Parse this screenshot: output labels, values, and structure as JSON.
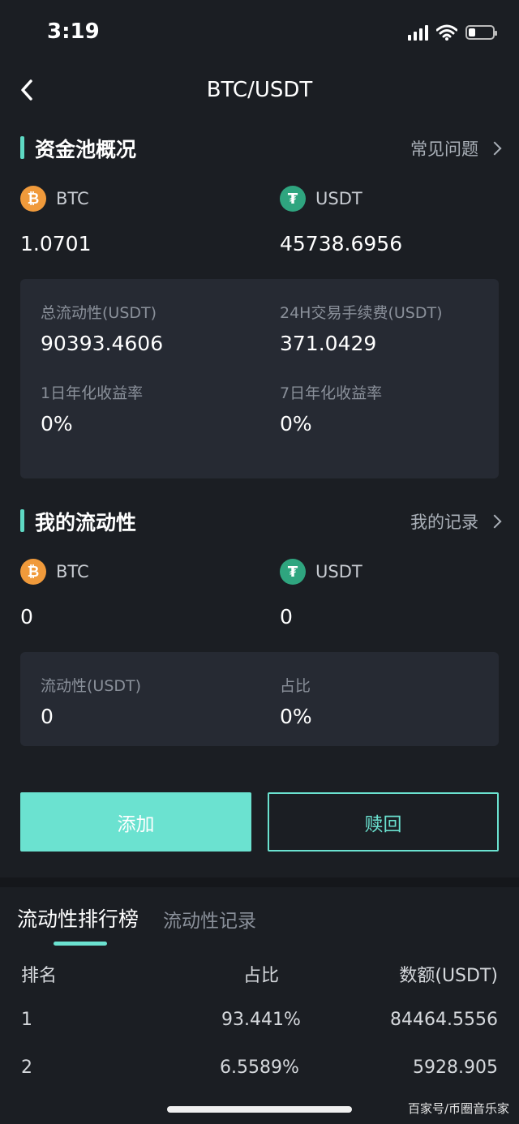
{
  "status": {
    "time": "3:19"
  },
  "nav": {
    "title": "BTC/USDT"
  },
  "pool": {
    "title": "资金池概况",
    "faq_link": "常见问题",
    "coin1": {
      "symbol": "BTC",
      "amount": "1.0701"
    },
    "coin2": {
      "symbol": "USDT",
      "amount": "45738.6956"
    },
    "stats": {
      "total_label": "总流动性(USDT)",
      "total_value": "90393.4606",
      "fee_label": "24H交易手续费(USDT)",
      "fee_value": "371.0429",
      "apy1_label": "1日年化收益率",
      "apy1_value": "0%",
      "apy7_label": "7日年化收益率",
      "apy7_value": "0%"
    }
  },
  "mine": {
    "title": "我的流动性",
    "records_link": "我的记录",
    "coin1": {
      "symbol": "BTC",
      "amount": "0"
    },
    "coin2": {
      "symbol": "USDT",
      "amount": "0"
    },
    "stats": {
      "liq_label": "流动性(USDT)",
      "liq_value": "0",
      "share_label": "占比",
      "share_value": "0%"
    }
  },
  "actions": {
    "add": "添加",
    "redeem": "赎回"
  },
  "tabs": {
    "ranking": "流动性排行榜",
    "records": "流动性记录"
  },
  "table": {
    "headers": [
      "排名",
      "占比",
      "数额(USDT)"
    ],
    "rows": [
      [
        "1",
        "93.441%",
        "84464.5556"
      ],
      [
        "2",
        "6.5589%",
        "5928.905"
      ]
    ]
  },
  "watermark": "百家号/币圈音乐家",
  "colors": {
    "accent": "#6be2d0",
    "btc": "#f09a3b",
    "usdt": "#2fa57f",
    "background": "#1b1e23",
    "card": "#262a33"
  }
}
